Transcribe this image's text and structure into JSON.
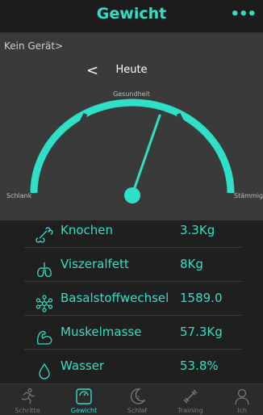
{
  "header": {
    "title": "Gewicht",
    "more_label": "•••"
  },
  "gauge": {
    "device_label": "Kein Gerät>",
    "date_label": "Heute",
    "prev_label": "<",
    "top_label": "Gesundheit",
    "left_label": "Schlank",
    "right_label": "Stämmig",
    "accent": "#2fe0c8"
  },
  "metrics": [
    {
      "icon": "bone-icon",
      "label": "Knochen",
      "value": "3.3Kg"
    },
    {
      "icon": "lungs-icon",
      "label": "Viszeralfett",
      "value": "8Kg"
    },
    {
      "icon": "molecule-icon",
      "label": "Basalstoffwechsel",
      "value": "1589.0"
    },
    {
      "icon": "muscle-icon",
      "label": "Muskelmasse",
      "value": "57.3Kg"
    },
    {
      "icon": "water-drop-icon",
      "label": "Wasser",
      "value": "53.8%"
    }
  ],
  "tabs": [
    {
      "icon": "running-icon",
      "label": "Schritte",
      "active": false
    },
    {
      "icon": "scale-icon",
      "label": "Gewicht",
      "active": true
    },
    {
      "icon": "moon-icon",
      "label": "Schlaf",
      "active": false
    },
    {
      "icon": "dumbbell-icon",
      "label": "Training",
      "active": false
    },
    {
      "icon": "person-icon",
      "label": "Ich",
      "active": false
    }
  ]
}
